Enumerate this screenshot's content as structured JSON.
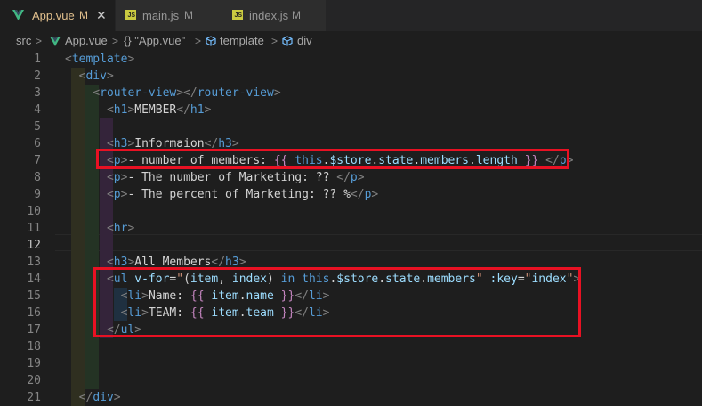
{
  "tabs": [
    {
      "label": "App.vue",
      "status": "M",
      "active": true,
      "icon": "vue-icon"
    },
    {
      "label": "main.js",
      "status": "M",
      "active": false,
      "icon": "js-icon"
    },
    {
      "label": "index.js",
      "status": "M",
      "active": false,
      "icon": "js-icon"
    }
  ],
  "js_icon_text": "JS",
  "close_glyph": "✕",
  "breadcrumb": {
    "items": [
      "src",
      "App.vue",
      "{} \"App.vue\"",
      "template",
      "div"
    ],
    "separator": ">"
  },
  "editor": {
    "current_line": 12,
    "line_numbers": [
      "1",
      "2",
      "3",
      "4",
      "5",
      "6",
      "7",
      "8",
      "9",
      "10",
      "11",
      "12",
      "13",
      "14",
      "15",
      "16",
      "17",
      "18",
      "19",
      "20",
      "21"
    ],
    "lines": [
      {
        "indent": "",
        "tokens": [
          [
            "b",
            "<"
          ],
          [
            "t",
            "template"
          ],
          [
            "b",
            ">"
          ]
        ]
      },
      {
        "indent": "  ",
        "tokens": [
          [
            "b",
            "<"
          ],
          [
            "t",
            "div"
          ],
          [
            "b",
            ">"
          ]
        ]
      },
      {
        "indent": "    ",
        "tokens": [
          [
            "b",
            "<"
          ],
          [
            "t",
            "router-view"
          ],
          [
            "b",
            "></"
          ],
          [
            "t",
            "router-view"
          ],
          [
            "b",
            ">"
          ]
        ]
      },
      {
        "indent": "      ",
        "tokens": [
          [
            "b",
            "<"
          ],
          [
            "t",
            "h1"
          ],
          [
            "b",
            ">"
          ],
          [
            "w",
            "MEMBER"
          ],
          [
            "b",
            "</"
          ],
          [
            "t",
            "h1"
          ],
          [
            "b",
            ">"
          ]
        ]
      },
      {
        "indent": "",
        "tokens": []
      },
      {
        "indent": "      ",
        "tokens": [
          [
            "b",
            "<"
          ],
          [
            "t",
            "h3"
          ],
          [
            "b",
            ">"
          ],
          [
            "w",
            "Informaion"
          ],
          [
            "b",
            "</"
          ],
          [
            "t",
            "h3"
          ],
          [
            "b",
            ">"
          ]
        ]
      },
      {
        "indent": "      ",
        "tokens": [
          [
            "b",
            "<"
          ],
          [
            "t",
            "p"
          ],
          [
            "b",
            ">"
          ],
          [
            "w",
            "- number of members: "
          ],
          [
            "k",
            "{{"
          ],
          [
            "w",
            " "
          ],
          [
            "t",
            "this"
          ],
          [
            "w",
            "."
          ],
          [
            "v",
            "$store"
          ],
          [
            "w",
            "."
          ],
          [
            "v",
            "state"
          ],
          [
            "w",
            "."
          ],
          [
            "v",
            "members"
          ],
          [
            "w",
            "."
          ],
          [
            "v",
            "length"
          ],
          [
            "w",
            " "
          ],
          [
            "k",
            "}}"
          ],
          [
            "w",
            " "
          ],
          [
            "b",
            "</"
          ],
          [
            "t",
            "p"
          ],
          [
            "b",
            ">"
          ]
        ]
      },
      {
        "indent": "      ",
        "tokens": [
          [
            "b",
            "<"
          ],
          [
            "t",
            "p"
          ],
          [
            "b",
            ">"
          ],
          [
            "w",
            "- The number of Marketing: ?? "
          ],
          [
            "b",
            "</"
          ],
          [
            "t",
            "p"
          ],
          [
            "b",
            ">"
          ]
        ]
      },
      {
        "indent": "      ",
        "tokens": [
          [
            "b",
            "<"
          ],
          [
            "t",
            "p"
          ],
          [
            "b",
            ">"
          ],
          [
            "w",
            "- The percent of Marketing: ?? %"
          ],
          [
            "b",
            "</"
          ],
          [
            "t",
            "p"
          ],
          [
            "b",
            ">"
          ]
        ]
      },
      {
        "indent": "",
        "tokens": []
      },
      {
        "indent": "      ",
        "tokens": [
          [
            "b",
            "<"
          ],
          [
            "t",
            "hr"
          ],
          [
            "b",
            ">"
          ]
        ]
      },
      {
        "indent": "",
        "tokens": []
      },
      {
        "indent": "      ",
        "tokens": [
          [
            "b",
            "<"
          ],
          [
            "t",
            "h3"
          ],
          [
            "b",
            ">"
          ],
          [
            "w",
            "All Members"
          ],
          [
            "b",
            "</"
          ],
          [
            "t",
            "h3"
          ],
          [
            "b",
            ">"
          ]
        ]
      },
      {
        "indent": "      ",
        "tokens": [
          [
            "b",
            "<"
          ],
          [
            "t",
            "ul"
          ],
          [
            "w",
            " "
          ],
          [
            "a",
            "v-for"
          ],
          [
            "w",
            "="
          ],
          [
            "s",
            "\""
          ],
          [
            "w",
            "("
          ],
          [
            "v",
            "item"
          ],
          [
            "w",
            ", "
          ],
          [
            "v",
            "index"
          ],
          [
            "w",
            ") "
          ],
          [
            "t",
            "in"
          ],
          [
            "w",
            " "
          ],
          [
            "t",
            "this"
          ],
          [
            "w",
            "."
          ],
          [
            "v",
            "$store"
          ],
          [
            "w",
            "."
          ],
          [
            "v",
            "state"
          ],
          [
            "w",
            "."
          ],
          [
            "v",
            "members"
          ],
          [
            "s",
            "\""
          ],
          [
            "w",
            " "
          ],
          [
            "a",
            ":key"
          ],
          [
            "w",
            "="
          ],
          [
            "s",
            "\""
          ],
          [
            "v",
            "index"
          ],
          [
            "s",
            "\""
          ],
          [
            "b",
            ">"
          ]
        ]
      },
      {
        "indent": "        ",
        "tokens": [
          [
            "b",
            "<"
          ],
          [
            "t",
            "li"
          ],
          [
            "b",
            ">"
          ],
          [
            "w",
            "Name: "
          ],
          [
            "k",
            "{{"
          ],
          [
            "w",
            " "
          ],
          [
            "v",
            "item"
          ],
          [
            "w",
            "."
          ],
          [
            "v",
            "name"
          ],
          [
            "w",
            " "
          ],
          [
            "k",
            "}}"
          ],
          [
            "b",
            "</"
          ],
          [
            "t",
            "li"
          ],
          [
            "b",
            ">"
          ]
        ]
      },
      {
        "indent": "        ",
        "tokens": [
          [
            "b",
            "<"
          ],
          [
            "t",
            "li"
          ],
          [
            "b",
            ">"
          ],
          [
            "w",
            "TEAM: "
          ],
          [
            "k",
            "{{"
          ],
          [
            "w",
            " "
          ],
          [
            "v",
            "item"
          ],
          [
            "w",
            "."
          ],
          [
            "v",
            "team"
          ],
          [
            "w",
            " "
          ],
          [
            "k",
            "}}"
          ],
          [
            "b",
            "</"
          ],
          [
            "t",
            "li"
          ],
          [
            "b",
            ">"
          ]
        ]
      },
      {
        "indent": "      ",
        "tokens": [
          [
            "b",
            "</"
          ],
          [
            "t",
            "ul"
          ],
          [
            "b",
            ">"
          ]
        ]
      },
      {
        "indent": "",
        "tokens": []
      },
      {
        "indent": "",
        "tokens": []
      },
      {
        "indent": "",
        "tokens": []
      },
      {
        "indent": "  ",
        "tokens": [
          [
            "b",
            "</"
          ],
          [
            "t",
            "div"
          ],
          [
            "b",
            ">"
          ]
        ]
      }
    ]
  },
  "colors": {
    "highlight_box": "#e81123",
    "modified": "#e2c08d",
    "vue_green": "#41b883",
    "js_yellow": "#cbcb41"
  }
}
